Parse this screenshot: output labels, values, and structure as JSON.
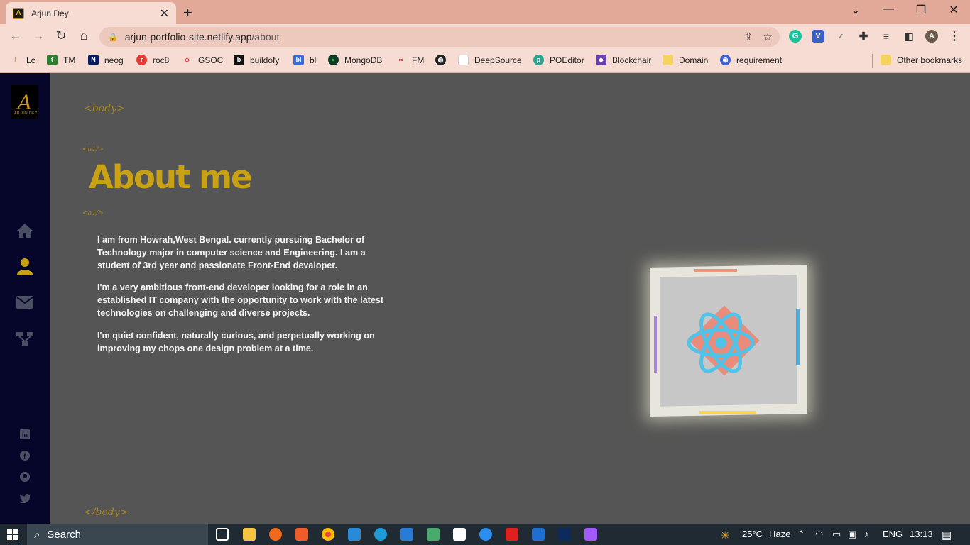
{
  "browser": {
    "tab_title": "Arjun Dey",
    "url_host": "arjun-portfolio-site.netlify.app",
    "url_path": "/about",
    "bookmarks": [
      "Lc",
      "TM",
      "neog",
      "roc8",
      "GSOC",
      "buildofy",
      "bl",
      "MongoDB",
      "FM",
      "DeepSource",
      "POEditor",
      "Blockchair",
      "Domain",
      "requirement"
    ],
    "other_bookmarks": "Other bookmarks"
  },
  "page": {
    "logo_text": "ARJUN DEY",
    "body_open_tag": "<body>",
    "h1_open_tag": "<h1/>",
    "heading": "About me",
    "h1_close_tag": "<h1/>",
    "body_close_tag": "</body>",
    "paragraphs": [
      "I am from Howrah,West Bengal. currently pursuing Bachelor of Technology major in computer science and Engineering. I am a student of 3rd year and passionate Front-End devaloper.",
      "I'm a very ambitious front-end developer looking for a role in an established IT company with the opportunity to work with the latest technologies on challenging and diverse projects.",
      "I'm quiet confident, naturally curious, and perpetually working on improving my chops one design problem at a time."
    ],
    "accent_color": "#c9a114",
    "sidebar_color": "#06062b"
  },
  "taskbar": {
    "search_label": "Search",
    "weather": "25°C",
    "weather_desc": "Haze",
    "lang": "ENG",
    "time": "13:13"
  }
}
